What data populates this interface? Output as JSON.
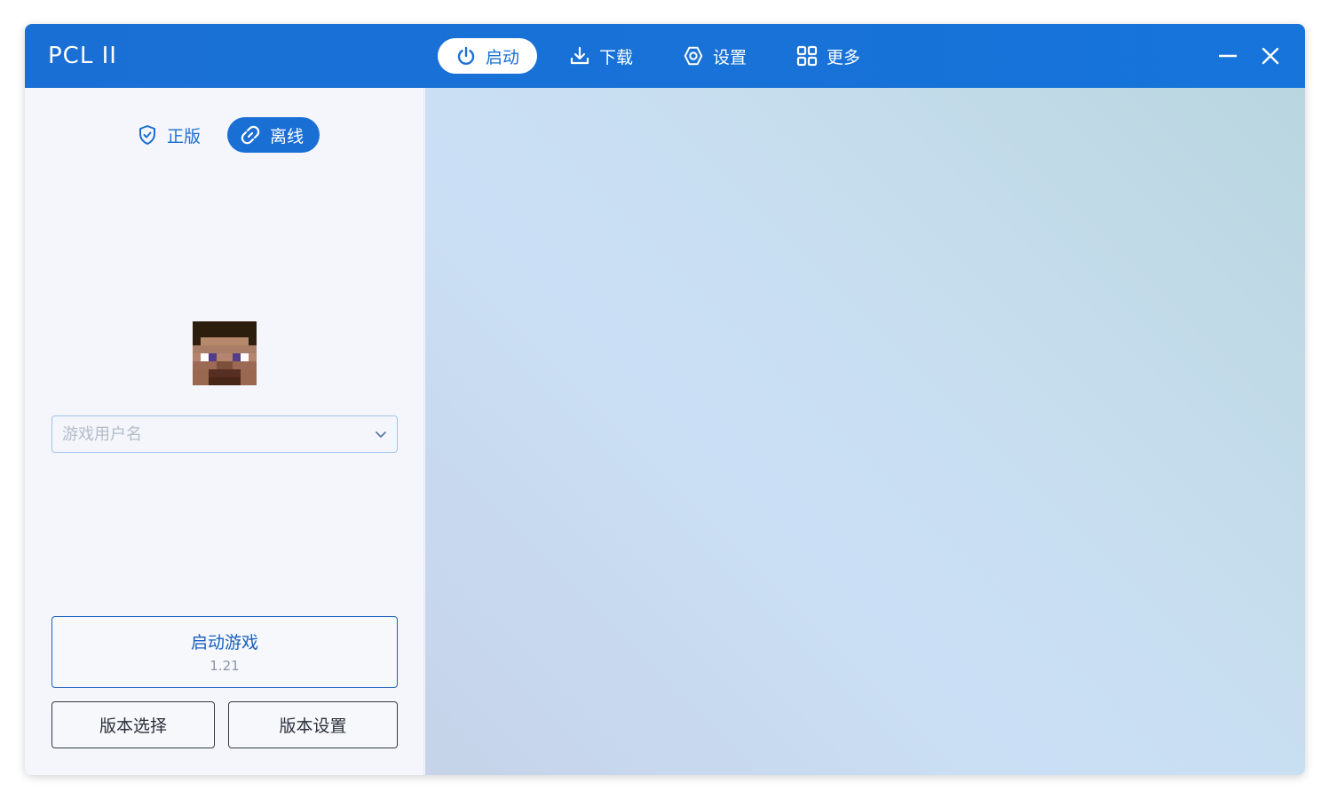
{
  "titlebar": {
    "app_title": "PCL II",
    "nav": [
      {
        "label": "启动",
        "icon": "power-icon",
        "active": true
      },
      {
        "label": "下载",
        "icon": "download-icon",
        "active": false
      },
      {
        "label": "设置",
        "icon": "settings-icon",
        "active": false
      },
      {
        "label": "更多",
        "icon": "grid-icon",
        "active": false
      }
    ],
    "controls": {
      "minimize_icon": "minimize-icon",
      "close_icon": "close-icon"
    }
  },
  "sidebar": {
    "mode_tabs": [
      {
        "label": "正版",
        "icon": "shield-check-icon",
        "active": false
      },
      {
        "label": "离线",
        "icon": "link-icon",
        "active": true
      }
    ],
    "avatar": "steve-skin-avatar",
    "username": {
      "value": "",
      "placeholder": "游戏用户名"
    },
    "launch": {
      "title": "启动游戏",
      "version": "1.21"
    },
    "version_select_label": "版本选择",
    "version_settings_label": "版本设置"
  },
  "colors": {
    "accent": "#1a6fd4",
    "titlebar": "#1674da",
    "sidebar_bg": "#f4f6fb",
    "placeholder": "#b4bcc8"
  }
}
